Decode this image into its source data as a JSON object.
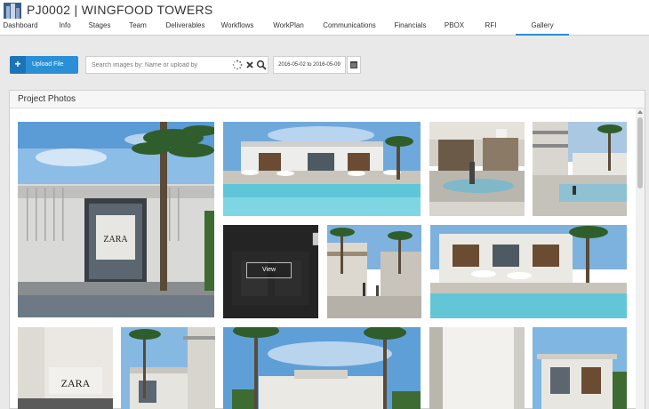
{
  "header": {
    "project_code": "PJ0002",
    "separator": "|",
    "project_name": "WINGFOOD TOWERS"
  },
  "nav": {
    "items": [
      "Dashboard",
      "Info",
      "Stages",
      "Team",
      "Deliverables",
      "Workflows",
      "WorkPlan",
      "Communications",
      "Financials",
      "PBOX",
      "RFI",
      "Gallery"
    ],
    "active": "Gallery"
  },
  "toolbar": {
    "upload_label": "Upload File",
    "search_placeholder": "Search images by: Name or upload by",
    "date_range": "2016-05-02 to 2016-05-09"
  },
  "panel": {
    "title": "Project Photos"
  },
  "photos": {
    "hover_view_label": "View",
    "store_sign": "ZARA"
  },
  "icons": {
    "upload": "plus-icon",
    "loading": "spinner-icon",
    "clear": "close-icon",
    "search": "search-icon",
    "calendar": "calendar-icon",
    "delete": "trash-icon",
    "info": "info-icon",
    "download": "cloud-download-icon",
    "edit": "pencil-icon",
    "pointer": "hand-cursor-icon"
  },
  "colors": {
    "accent": "#2a8fd6",
    "background": "#e9e9e9",
    "panel": "#ffffff"
  }
}
